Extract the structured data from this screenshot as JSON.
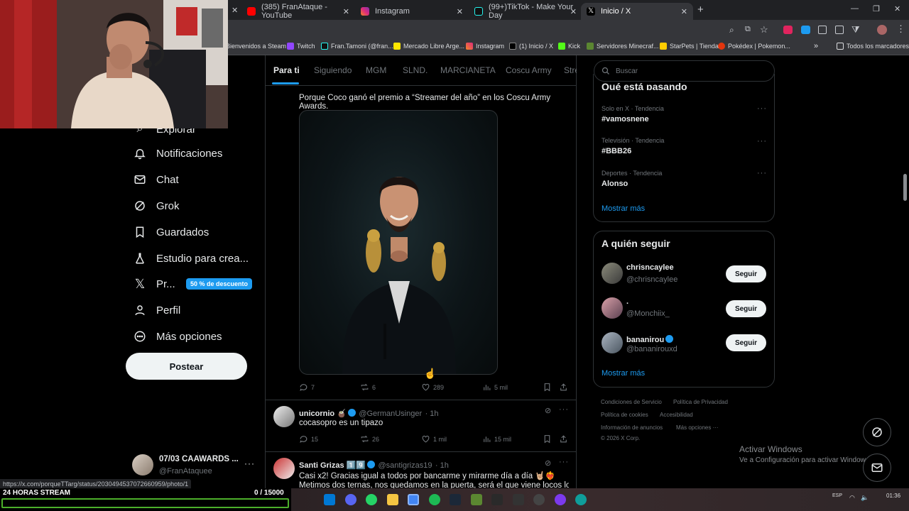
{
  "tabs": [
    {
      "label": "(385) FranAtaque - YouTube",
      "icon": "youtube-icon",
      "color": "#ff0000"
    },
    {
      "label": "Instagram",
      "icon": "instagram-icon",
      "color": "#e1306c"
    },
    {
      "label": "(99+)TikTok - Make Your Day",
      "icon": "tiktok-icon",
      "color": "#111111"
    },
    {
      "label": "Inicio / X",
      "icon": "x-icon",
      "color": "#000000"
    }
  ],
  "bookmarks": [
    {
      "label": "Bienvenidos a Steam",
      "color": "#1b2838"
    },
    {
      "label": "Twitch",
      "color": "#9146ff"
    },
    {
      "label": "Fran.Tamoni (@fran...",
      "color": "#111111"
    },
    {
      "label": "Mercado Libre Arge...",
      "color": "#ffe600"
    },
    {
      "label": "Instagram",
      "color": "#e1306c"
    },
    {
      "label": "(1) Inicio / X",
      "color": "#000000"
    },
    {
      "label": "Kick",
      "color": "#53fc18"
    },
    {
      "label": "Servidores Minecraf...",
      "color": "#5b8731"
    },
    {
      "label": "StarPets | Tienda",
      "color": "#ffcc00"
    },
    {
      "label": "Pokédex | Pokemon...",
      "color": "#e3350d"
    }
  ],
  "bookmarks_all": "Todos los marcadores",
  "nav": {
    "explore": "Explorar",
    "notifications": "Notificaciones",
    "chat": "Chat",
    "grok": "Grok",
    "saved": "Guardados",
    "studio": "Estudio para crea...",
    "premium": "Pr...",
    "premium_badge": "50 % de descuento",
    "profile": "Perfil",
    "more": "Más opciones",
    "post_button": "Postear"
  },
  "account": {
    "name": "07/03 CAAWARDS ...",
    "handle": "@FranAtaquee"
  },
  "feed_tabs": [
    "Para ti",
    "Siguiendo",
    "MGM",
    "SLND.",
    "MARCIANETA",
    "Coscu Army",
    "Stre"
  ],
  "post1": {
    "text": "Porque Coco ganó el premio a “Streamer del año” en los Coscu Army Awards.",
    "replies": "7",
    "reposts": "6",
    "likes": "289",
    "views": "5 mil"
  },
  "post2": {
    "name": "unicornio 🧉",
    "handle": "@GermanUsinger",
    "time": "· 1h",
    "text": "cocasopro es un tipazo",
    "replies": "15",
    "reposts": "26",
    "likes": "1 mil",
    "views": "15 mil"
  },
  "post3": {
    "name": "Santi Grizas 1️⃣9️⃣",
    "handle": "@santigrizas19",
    "time": "· 1h",
    "line1": "Casi x2! Gracias igual a todos por bancarme y mirarme día a día 🤘🏼❤️‍🔥",
    "line2": "Metimos dos ternas, nos quedamos en la puerta, será el que viene locos los"
  },
  "search_placeholder": "Buscar",
  "trends": {
    "title": "Qué está pasando",
    "items": [
      {
        "meta": "Solo en X · Tendencia",
        "name": "#vamosnene"
      },
      {
        "meta": "Televisión · Tendencia",
        "name": "#BBB26"
      },
      {
        "meta": "Deportes · Tendencia",
        "name": "Alonso"
      }
    ],
    "more": "Mostrar más"
  },
  "who_to_follow": {
    "title": "A quién seguir",
    "users": [
      {
        "name": "chrisncaylee",
        "handle": "@chrisncaylee",
        "button": "Seguir"
      },
      {
        "name": ".",
        "handle": "@Monchiix_",
        "button": "Seguir"
      },
      {
        "name": "bananirou",
        "handle": "@bananirouxd",
        "button": "Seguir"
      }
    ],
    "more": "Mostrar más"
  },
  "footer": {
    "terms": "Condiciones de Servicio",
    "privacy": "Política de Privacidad",
    "cookies": "Política de cookies",
    "accessibility": "Accesibilidad",
    "ads": "Información de anuncios",
    "more": "Más opciones ···",
    "copyright": "© 2026 X Corp."
  },
  "watermark": {
    "title": "Activar Windows",
    "subtitle": "Ve a Configuración para activar Windows."
  },
  "status_url": "https://x.com/porqueTTarg/status/2030494537072660959/photo/1",
  "stream_overlay": {
    "label": "24 HORAS STREAM",
    "current": "0",
    "goal": "/ 15000",
    "progress": 0
  },
  "clock": {
    "lang": "ESP",
    "time": "01:36"
  },
  "colors": {
    "accent": "#1d9bf0",
    "background": "#000000",
    "border": "#2f3336",
    "muted": "#71767b",
    "stream_green": "#4caf2a"
  }
}
